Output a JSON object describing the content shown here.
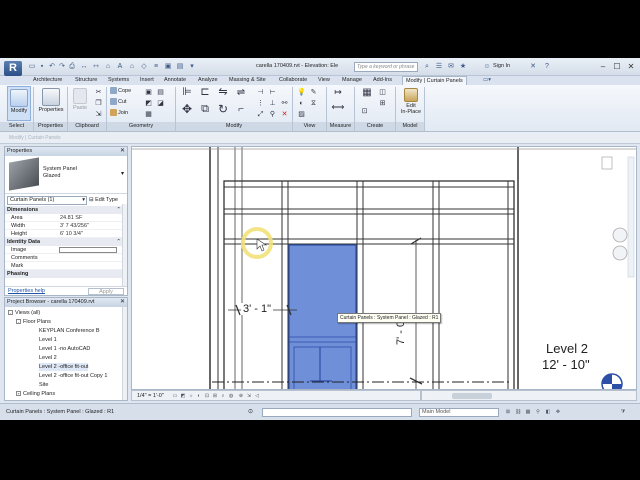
{
  "app": {
    "logo": "R",
    "doc_title": "carella 170409.rvt - Elevation: Ele",
    "search_placeholder": "Type a keyword or phrase",
    "signin": "Sign In",
    "window_buttons": [
      "–",
      "☐",
      "✕"
    ]
  },
  "tabs": [
    "Architecture",
    "Structure",
    "Systems",
    "Insert",
    "Annotate",
    "Analyze",
    "Massing & Site",
    "Collaborate",
    "View",
    "Manage",
    "Add-Ins",
    "Modify | Curtain Panels"
  ],
  "ribbon": {
    "select": {
      "modify_label": "Modify",
      "panel": "Select"
    },
    "properties": {
      "label": "Properties",
      "panel": "Properties"
    },
    "clipboard": {
      "paste": "Paste",
      "panel": "Clipboard"
    },
    "geometry": {
      "cope": "Cope",
      "cut": "Cut",
      "join": "Join",
      "panel": "Geometry"
    },
    "modify_panel": "Modify",
    "view_panel": "View",
    "measure_panel": "Measure",
    "create_panel": "Create",
    "model": {
      "edit_in_place": "Edit In-Place",
      "edit": "Edit",
      "in_place": "In-Place",
      "panel": "Model"
    }
  },
  "context_bar": {
    "text": "Modify | Curtain Panels"
  },
  "properties": {
    "header": "Properties",
    "type_family": "System Panel",
    "type_name": "Glazed",
    "instance_selector": "Curtain Panels (1)",
    "edit_type": "Edit Type",
    "groups": {
      "dimensions": "Dimensions",
      "identity": "Identity Data",
      "phasing": "Phasing"
    },
    "rows": {
      "area": {
        "k": "Area",
        "v": "24.81 SF"
      },
      "width": {
        "k": "Width",
        "v": "3' 7 43/256\""
      },
      "height": {
        "k": "Height",
        "v": "6' 10 3/4\""
      },
      "image": {
        "k": "Image"
      },
      "comments": {
        "k": "Comments"
      },
      "mark": {
        "k": "Mark"
      }
    },
    "help_link": "Properties help",
    "apply": "Apply"
  },
  "browser": {
    "header": "Project Browser - carella 170409.rvt",
    "items": [
      {
        "label": "Views (all)",
        "toggle": "-"
      },
      {
        "label": "Floor Plans",
        "toggle": "-"
      },
      {
        "label": "KEYPLAN Conference B"
      },
      {
        "label": "Level 1"
      },
      {
        "label": "Level 1 -no AutoCAD"
      },
      {
        "label": "Level 2"
      },
      {
        "label": "Level 2 -office fit-out"
      },
      {
        "label": "Level 2 -office fit-out Copy 1"
      },
      {
        "label": "Site"
      },
      {
        "label": "Ceiling Plans",
        "toggle": "+"
      }
    ]
  },
  "canvas": {
    "dim_horizontal": "3' - 1\"",
    "dim_vertical": "7' - 0\"",
    "level_name": "Level 2",
    "level_elev": "12' - 10\"",
    "tooltip": "Curtain Panels : System Panel : Glazed : R1"
  },
  "view_control": {
    "scale": "1/4\" = 1'-0\""
  },
  "statusbar": {
    "text": "Curtain Panels : System Panel : Glazed : R1",
    "model": "Main Model"
  },
  "colors": {
    "panel_fill": "#6f8fd8",
    "panel_stroke": "#2d4fa8",
    "cursor_halo": "#f2e27a"
  }
}
